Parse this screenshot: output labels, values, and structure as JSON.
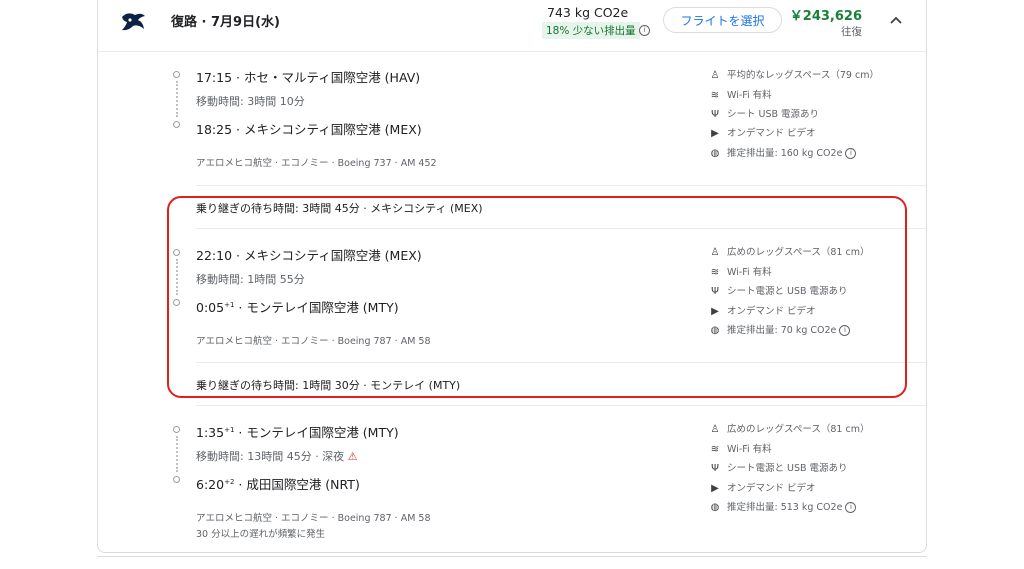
{
  "header": {
    "title": "復路 · 7月9日(水)",
    "co2": "743 kg CO2e",
    "co2_badge": "18% 少ない排出量",
    "select_label": "フライトを選択",
    "price": "￥243,626",
    "price_type": "往復"
  },
  "segments": [
    {
      "dep": "17:15 · ホセ・マルティ国際空港 (HAV)",
      "duration": "移動時間: 3時間 10分",
      "arr_time": "18:25",
      "arr_sup": "",
      "arr_airport": " · メキシコシティ国際空港 (MEX)",
      "carrier": "アエロメヒコ航空 · エコノミー · Boeing 737 · AM 452",
      "amenities": [
        "平均的なレッグスペース（79 cm）",
        "Wi-Fi 有料",
        "シート USB 電源あり",
        "オンデマンド ビデオ",
        "推定排出量: 160 kg CO2e"
      ]
    },
    {
      "dep": "22:10 · メキシコシティ国際空港 (MEX)",
      "duration": "移動時間: 1時間 55分",
      "arr_time": "0:05",
      "arr_sup": "+1",
      "arr_airport": " · モンテレイ国際空港 (MTY)",
      "carrier": "アエロメヒコ航空 · エコノミー · Boeing 787 · AM 58",
      "amenities": [
        "広めのレッグスペース（81 cm）",
        "Wi-Fi 有料",
        "シート電源と USB 電源あり",
        "オンデマンド ビデオ",
        "推定排出量: 70 kg CO2e"
      ]
    },
    {
      "dep_time": "1:35",
      "dep_sup": "+1",
      "dep_airport": " · モンテレイ国際空港 (MTY)",
      "duration": "移動時間: 13時間 45分 · 深夜",
      "arr_time": "6:20",
      "arr_sup": "+2",
      "arr_airport": " · 成田国際空港 (NRT)",
      "carrier": "アエロメヒコ航空 · エコノミー · Boeing 787 · AM 58",
      "delay_note": "30 分以上の遅れが頻繁に発生",
      "amenities": [
        "広めのレッグスペース（81 cm）",
        "Wi-Fi 有料",
        "シート電源と USB 電源あり",
        "オンデマンド ビデオ",
        "推定排出量: 513 kg CO2e"
      ]
    }
  ],
  "layovers": [
    "乗り継ぎの待ち時間: 3時間 45分 · メキシコシティ (MEX)",
    "乗り継ぎの待ち時間: 1時間 30分 · モンテレイ (MTY)"
  ],
  "icons": [
    "seat-icon",
    "wifi-icon",
    "usb-icon",
    "video-icon",
    "globe-icon"
  ]
}
